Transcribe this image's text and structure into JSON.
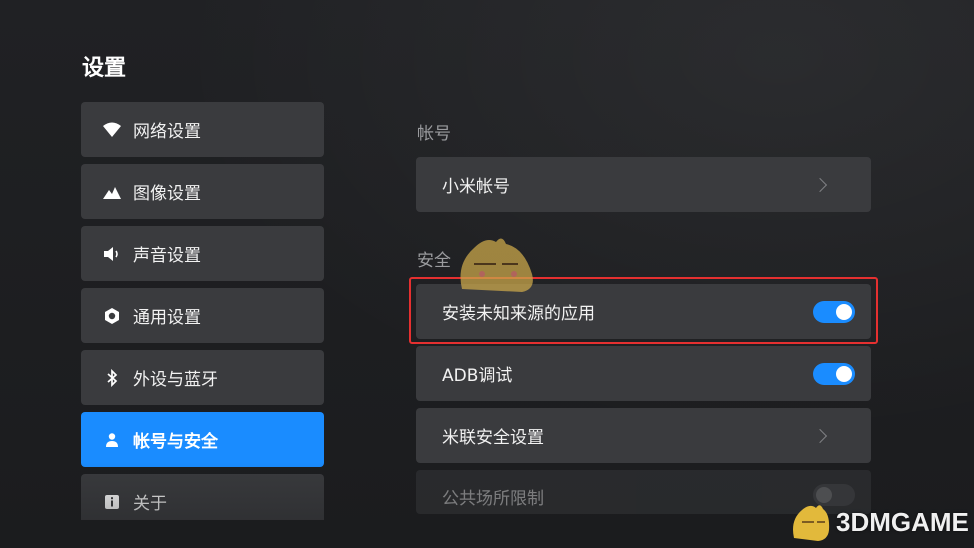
{
  "page": {
    "title": "设置"
  },
  "sidebar": {
    "items": [
      {
        "label": "网络设置",
        "icon": "wifi-icon",
        "active": false
      },
      {
        "label": "图像设置",
        "icon": "mountain-icon",
        "active": false
      },
      {
        "label": "声音设置",
        "icon": "speaker-icon",
        "active": false
      },
      {
        "label": "通用设置",
        "icon": "gear-icon",
        "active": false
      },
      {
        "label": "外设与蓝牙",
        "icon": "bluetooth-icon",
        "active": false
      },
      {
        "label": "帐号与安全",
        "icon": "person-icon",
        "active": true
      },
      {
        "label": "关于",
        "icon": "info-icon",
        "active": false
      }
    ]
  },
  "main": {
    "account_section": {
      "title": "帐号",
      "rows": [
        {
          "label": "小米帐号",
          "control": "chevron"
        }
      ]
    },
    "security_section": {
      "title": "安全",
      "rows": [
        {
          "label": "安装未知来源的应用",
          "control": "toggle",
          "on": true,
          "highlighted": true
        },
        {
          "label": "ADB调试",
          "control": "toggle",
          "on": true
        },
        {
          "label": "米联安全设置",
          "control": "chevron"
        },
        {
          "label": "公共场所限制",
          "control": "toggle",
          "on": false,
          "dimmed": true
        }
      ]
    }
  },
  "watermark": {
    "text": "3DMGAME"
  },
  "colors": {
    "accent": "#1a8cff",
    "highlight": "#e53030",
    "row_bg": "#3a3b3e",
    "page_bg": "#1c1d1f"
  }
}
